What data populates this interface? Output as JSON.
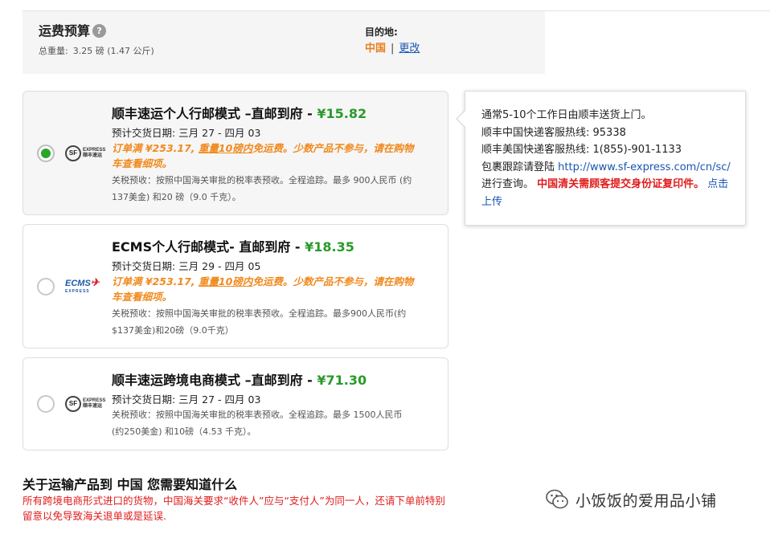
{
  "estimate": {
    "title": "运费预算",
    "help_glyph": "?",
    "weight_label": "总重量:",
    "weight_value": "3.25 磅 (1.47 公斤)",
    "destination_label": "目的地:",
    "destination_value": "中国",
    "separator": "|",
    "change_link": "更改"
  },
  "options": [
    {
      "selected": true,
      "logo": "sf-express-logo",
      "logo_text": "SF",
      "logo_sub": "EXPRESS 顺丰速运",
      "title": "顺丰速运个人行邮模式 –直邮到府 - ",
      "price": "¥15.82",
      "date": "预计交货日期: 三月 27 - 四月 03",
      "promo_a": "订单满 ¥253.17,",
      "promo_u": "重量10磅内",
      "promo_b": "免运费。少数产品不参与，请在购物车查看细项。",
      "customs": "关税预收：按照中国海关审批的税率表预收。全程追踪。最多 900人民币 (约137美金) 和20 磅（9.0 千克）。"
    },
    {
      "selected": false,
      "logo": "ecms-express-logo",
      "logo_text": "ECMS",
      "logo_sub": "EXPRESS",
      "title": "ECMS个人行邮模式- 直邮到府 - ",
      "price": "¥18.35",
      "date": "预计交货日期: 三月 29 - 四月 05",
      "promo_a": "订单满 ¥253.17,",
      "promo_u": "重量10磅内",
      "promo_b": "免运费。少数产品不参与，请在购物车查看细项。",
      "customs": "关税预收：按照中国海关审批的税率表预收。全程追踪。最多900人民币(约$137美金)和20磅（9.0千克）"
    },
    {
      "selected": false,
      "logo": "sf-express-logo",
      "logo_text": "SF",
      "logo_sub": "EXPRESS 顺丰速运",
      "title": "顺丰速运跨境电商模式 –直邮到府 - ",
      "price": "¥71.30",
      "date": "预计交货日期: 三月 27 - 四月 03",
      "customs": "关税预收：按照中国海关审批的税率表预收。全程追踪。最多 1500人民币 (约250美金) 和10磅（4.53 千克）。"
    }
  ],
  "info": {
    "line1": "通常5-10个工作日由顺丰送货上门。",
    "line2": "顺丰中国快递客服热线: 95338",
    "line3": "顺丰美国快递客服热线: 1(855)-901-1133",
    "track_prefix": "包裹跟踪请登陆 ",
    "track_url": "http://www.sf-express.com/cn/sc/",
    "track_suffix": " 进行查询。 ",
    "id_notice": "中国清关需顾客提交身份证复印件。",
    "upload_link": "点击上传"
  },
  "footer": {
    "title": "关于运输产品到 中国 您需要知道什么",
    "notice": "所有跨境电商形式进口的货物，中国海关要求“收件人”应与“支付人”为同一人，还请下单前特别留意以免导致海关退单或是延误."
  },
  "watermark": {
    "icon": "wechat-icon",
    "text": "小饭饭的爱用品小铺"
  },
  "colors": {
    "price_green": "#2a9a2a",
    "promo_orange": "#f08a1e",
    "destination_orange": "#e8801a",
    "link_blue": "#1a55b0",
    "warning_red": "#e01b1b",
    "radio_checked": "#2aa52a"
  }
}
